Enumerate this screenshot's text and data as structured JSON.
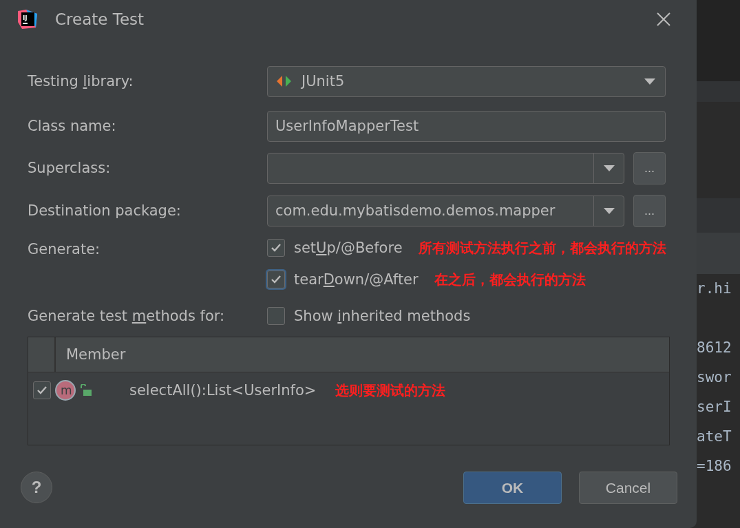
{
  "window": {
    "title": "Create Test",
    "logo_text": "IJ"
  },
  "fields": [
    {
      "kind": "dropdown",
      "label": [
        "Testing ",
        "l",
        "ibrary:"
      ],
      "value": "JUnit5",
      "icon": true
    },
    {
      "kind": "text",
      "label": [
        "Class name:"
      ],
      "value": "UserInfoMapperTest"
    },
    {
      "kind": "combo",
      "label": [
        "Superclass:"
      ],
      "browse": "..."
    },
    {
      "kind": "combo",
      "label": [
        "Destination package:"
      ],
      "value": "com.edu.mybatisdemo.demos.mapper",
      "browse": "..."
    }
  ],
  "generate": {
    "label": [
      "Generate:"
    ],
    "options": [
      {
        "label": [
          "set",
          "U",
          "p/@Before"
        ],
        "checked": true,
        "focused": false,
        "note": "所有测试方法执行之前，都会执行的方法"
      },
      {
        "label": [
          "tear",
          "D",
          "own/@After"
        ],
        "checked": true,
        "focused": true,
        "note": "在之后，都会执行的方法"
      }
    ]
  },
  "methods": {
    "label": [
      "Generate test ",
      "m",
      "ethods for:"
    ],
    "inherited": {
      "label": [
        "Show ",
        "i",
        "nherited methods"
      ],
      "checked": false
    },
    "table": {
      "columns": [
        "Member"
      ],
      "rows": [
        {
          "checked": true,
          "icon_letter": "m",
          "member": "selectAll():List<UserInfo>",
          "note": "选则要测试的方法"
        }
      ]
    }
  },
  "buttons": [
    {
      "label": "OK",
      "primary": true
    },
    {
      "label": "Cancel",
      "primary": false
    }
  ],
  "help": "?",
  "editor": {
    "lines": [
      "r.hi",
      "8612",
      "swor",
      "serI",
      "ateT",
      "=186"
    ]
  }
}
